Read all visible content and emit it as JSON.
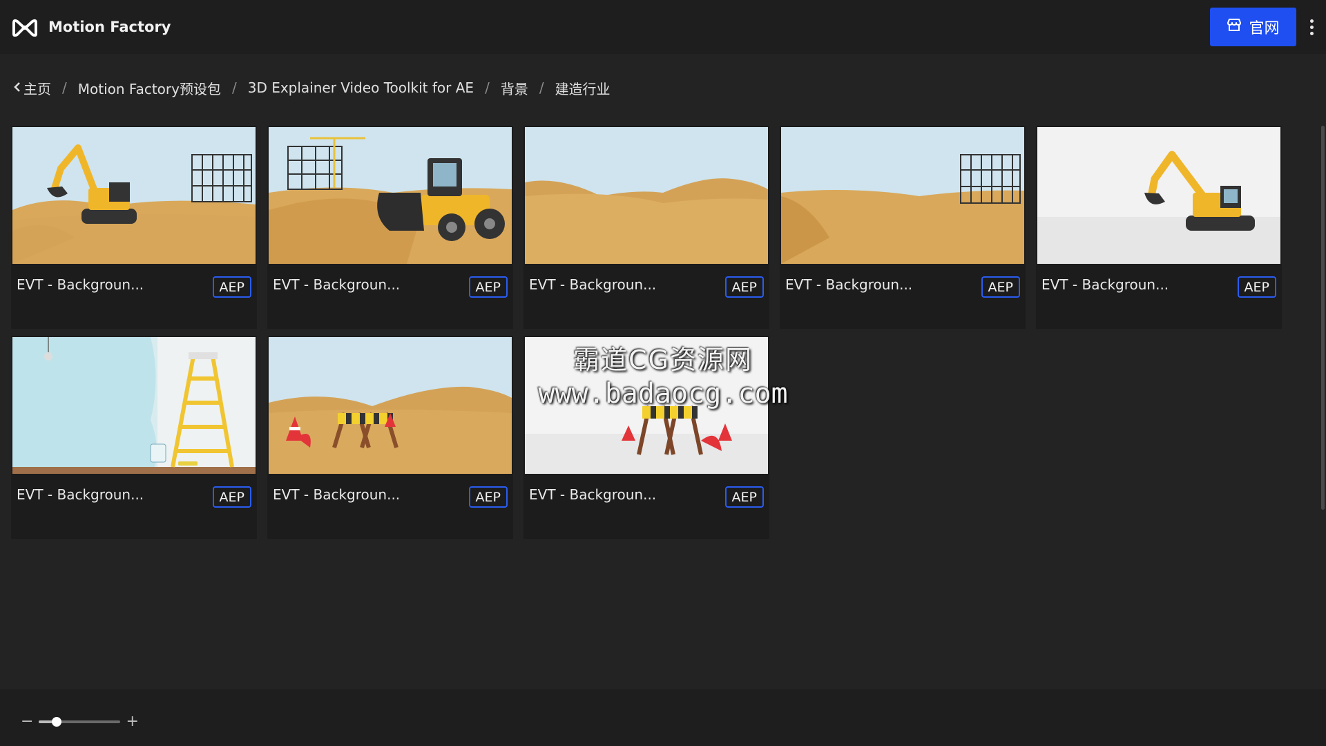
{
  "header": {
    "brand_name": "Motion Factory",
    "official_label": "官网",
    "logo_icon": "motion-factory-logo-icon",
    "store_icon": "store-icon",
    "more_icon": "kebab-menu-icon"
  },
  "breadcrumb": {
    "back_icon": "chevron-left-icon",
    "separator": "/",
    "items": [
      "主页",
      "Motion Factory预设包",
      "3D Explainer Video Toolkit for AE",
      "背景",
      "建造行业"
    ]
  },
  "cards": [
    {
      "title": "EVT - Backgroun...",
      "badge": "AEP",
      "scene": "excavator-with-building"
    },
    {
      "title": "EVT - Backgroun...",
      "badge": "AEP",
      "scene": "bulldozer-with-crane"
    },
    {
      "title": "EVT - Backgroun...",
      "badge": "AEP",
      "scene": "empty-sand-dunes"
    },
    {
      "title": "EVT - Backgroun...",
      "badge": "AEP",
      "scene": "dunes-with-building"
    },
    {
      "title": "EVT - Backgroun...",
      "badge": "AEP",
      "scene": "excavator-white-studio"
    },
    {
      "title": "EVT - Backgroun...",
      "badge": "AEP",
      "scene": "ladder-blue-wall"
    },
    {
      "title": "EVT - Backgroun...",
      "badge": "AEP",
      "scene": "barrier-cones-dunes"
    },
    {
      "title": "EVT - Backgroun...",
      "badge": "AEP",
      "scene": "barrier-cones-white-studio"
    }
  ],
  "watermark": {
    "line1": "霸道CG资源网",
    "line2": "www.badaocg.com"
  },
  "zoom": {
    "minus": "−",
    "plus": "+",
    "level": 0.22
  },
  "colors": {
    "accent": "#1f4ff0",
    "badge_border": "#2a5cf0",
    "background": "#232323"
  }
}
